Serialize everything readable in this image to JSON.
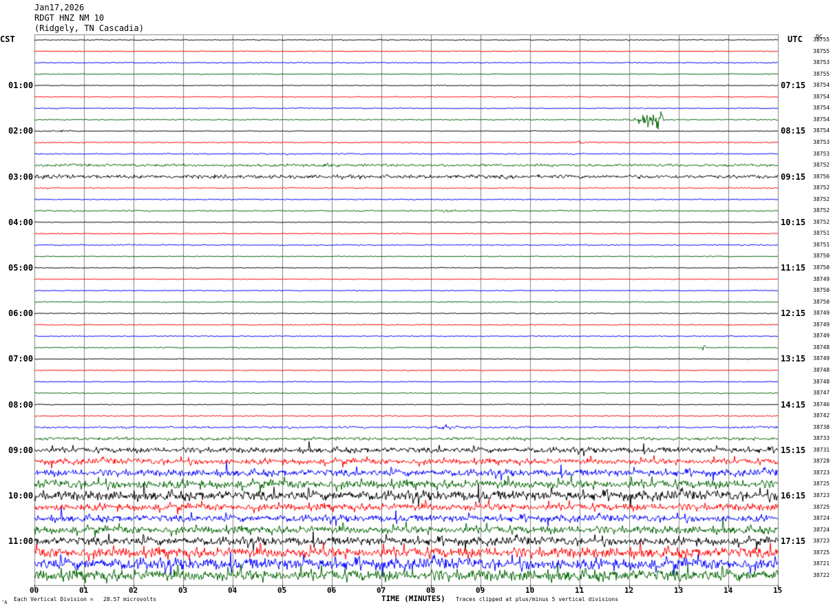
{
  "header": {
    "date": "Jan17,2026",
    "station": "RDGT HNZ NM 10",
    "location": "(Ridgely, TN Cascadia)"
  },
  "labels": {
    "left_timezone": "CST",
    "right_timezone": "UTC",
    "dc_label": "DC",
    "x_axis_title": "TIME (MINUTES)",
    "footer_left": "Each Vertical Division =   28.57 microvolts",
    "footer_right": "Traces clipped at plus/minus 5 vertical divisions",
    "scale_mark": "‘A"
  },
  "colors": {
    "row_cycle": [
      "#000000",
      "#ff0000",
      "#0000ff",
      "#006400"
    ],
    "grid": "#808080"
  },
  "chart_data": {
    "type": "line",
    "title": "RDGT HNZ NM 10",
    "xlabel": "TIME (MINUTES)",
    "ylabel": "",
    "x_ticks": [
      "00",
      "01",
      "02",
      "03",
      "04",
      "05",
      "06",
      "07",
      "08",
      "09",
      "10",
      "11",
      "12",
      "13",
      "14",
      "15"
    ],
    "xlim": [
      0,
      15
    ],
    "grid": true,
    "left_time_labels": [
      "01:00",
      "02:00",
      "03:00",
      "04:00",
      "05:00",
      "06:00",
      "07:00",
      "08:00",
      "09:00",
      "10:00",
      "11:00"
    ],
    "right_time_labels": [
      "07:15",
      "08:15",
      "09:15",
      "10:15",
      "11:15",
      "12:15",
      "13:15",
      "14:15",
      "15:15",
      "16:15",
      "17:15"
    ],
    "dc_offsets": [
      38755,
      38755,
      38753,
      38755,
      38754,
      38754,
      38754,
      38754,
      38754,
      38753,
      38753,
      38752,
      38756,
      38752,
      38752,
      38752,
      38752,
      38751,
      38751,
      38750,
      38750,
      38749,
      38750,
      38750,
      38749,
      38749,
      38749,
      38748,
      38749,
      38748,
      38748,
      38747,
      38746,
      38742,
      38738,
      38733,
      38731,
      38728,
      38723,
      38725,
      38723,
      38725,
      38724,
      38724,
      38723,
      38725,
      38721,
      38722
    ],
    "trace_noise_level": [
      0.4,
      0.4,
      0.5,
      0.4,
      0.4,
      0.4,
      0.5,
      0.5,
      0.4,
      0.5,
      0.6,
      1.2,
      1.6,
      0.5,
      0.5,
      0.6,
      0.4,
      0.4,
      0.6,
      0.4,
      0.4,
      0.4,
      0.4,
      0.5,
      0.4,
      0.5,
      0.5,
      0.5,
      0.4,
      0.4,
      0.5,
      0.4,
      0.4,
      0.5,
      0.9,
      1.4,
      2.4,
      2.6,
      3.0,
      3.8,
      4.2,
      3.2,
      3.0,
      3.4,
      3.6,
      4.6,
      5.0,
      5.0
    ],
    "events": [
      {
        "row": 7,
        "start_min": 11.7,
        "end_min": 12.7,
        "peak_min": 12.55,
        "amplitude_div": 3.5
      },
      {
        "row": 8,
        "start_min": 0.2,
        "end_min": 0.8,
        "peak_min": 0.5,
        "amplitude_div": 0.6
      },
      {
        "row": 9,
        "start_min": 10.8,
        "end_min": 11.4,
        "peak_min": 11.0,
        "amplitude_div": 0.6
      },
      {
        "row": 11,
        "start_min": 5.6,
        "end_min": 6.2,
        "peak_min": 5.9,
        "amplitude_div": 1.0
      },
      {
        "row": 12,
        "start_min": 0.0,
        "end_min": 1.3,
        "peak_min": 0.2,
        "amplitude_div": 1.2
      },
      {
        "row": 15,
        "start_min": 8.0,
        "end_min": 8.9,
        "peak_min": 8.3,
        "amplitude_div": 0.8
      },
      {
        "row": 27,
        "start_min": 13.4,
        "end_min": 13.6,
        "peak_min": 13.5,
        "amplitude_div": 1.0
      },
      {
        "row": 34,
        "start_min": 7.8,
        "end_min": 9.0,
        "peak_min": 8.3,
        "amplitude_div": 0.8
      }
    ]
  }
}
